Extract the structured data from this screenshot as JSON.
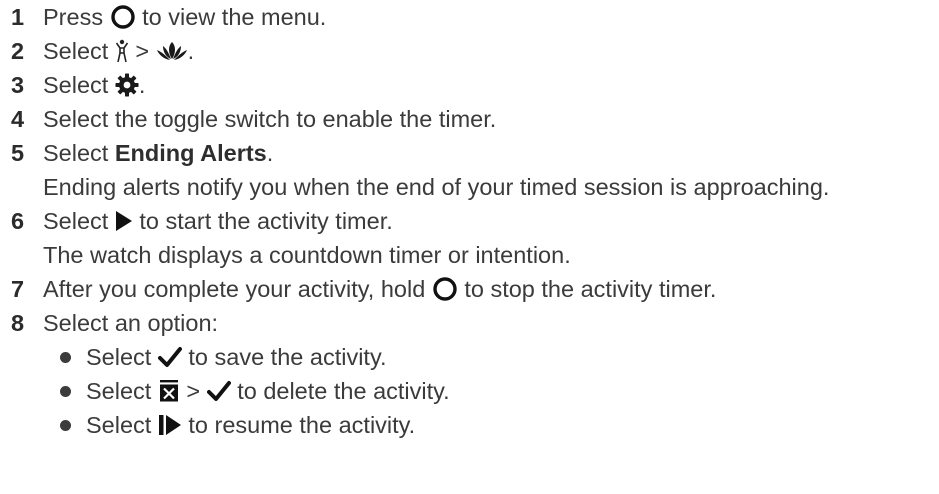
{
  "steps": [
    {
      "num": "1",
      "a": "Press",
      "b": "to view the menu."
    },
    {
      "num": "2",
      "a": "Select",
      "sep": ">",
      "end": "."
    },
    {
      "num": "3",
      "a": "Select",
      "end": "."
    },
    {
      "num": "4",
      "a": "Select the toggle switch to enable the timer."
    },
    {
      "num": "5",
      "a": "Select",
      "bold": "Ending Alerts",
      "end": ".",
      "cont": "Ending alerts notify you when the end of your timed session is approaching."
    },
    {
      "num": "6",
      "a": "Select",
      "b": "to start the activity timer.",
      "cont": "The watch displays a countdown timer or intention."
    },
    {
      "num": "7",
      "a": "After you complete your activity, hold",
      "b": "to stop the activity timer."
    },
    {
      "num": "8",
      "a": "Select an option:"
    }
  ],
  "options": [
    {
      "a": "Select",
      "b": "to save the activity."
    },
    {
      "a": "Select",
      "sep": ">",
      "b": "to delete the activity."
    },
    {
      "a": "Select",
      "b": "to resume the activity."
    }
  ],
  "icons": {
    "circle_button": "circle-button-icon",
    "activity": "activity-person-icon",
    "meditation": "lotus-icon",
    "settings": "gear-icon",
    "play": "play-icon",
    "check": "checkmark-icon",
    "discard": "discard-icon",
    "resume": "resume-icon"
  },
  "colors": {
    "text": "#3b3b3b",
    "number": "#2b2b2b"
  }
}
